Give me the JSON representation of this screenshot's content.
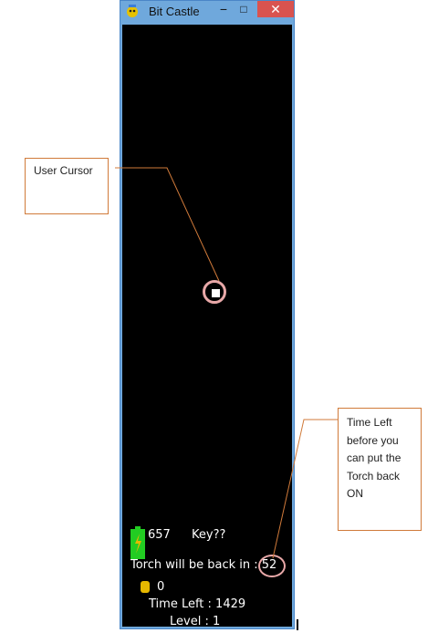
{
  "window": {
    "title": "Bit Castle"
  },
  "titlebar": {
    "minimize": "−",
    "maximize": "□",
    "close": "✕",
    "app_icon": "bit-castle-icon"
  },
  "hud": {
    "energy": "657",
    "key": "Key??",
    "torch_message": "Torch will be back in : 52",
    "coins": "0",
    "time_left": "Time Left : 1429",
    "level": "Level : 1",
    "battery_color": "#22cc22",
    "coin_color": "#e6b800"
  },
  "annotations": {
    "user_cursor": "User Cursor",
    "torch_callout": "Time Left before you can put the Torch back ON",
    "ring_color": "#e8a8a8",
    "line_color": "#d07a3a"
  }
}
